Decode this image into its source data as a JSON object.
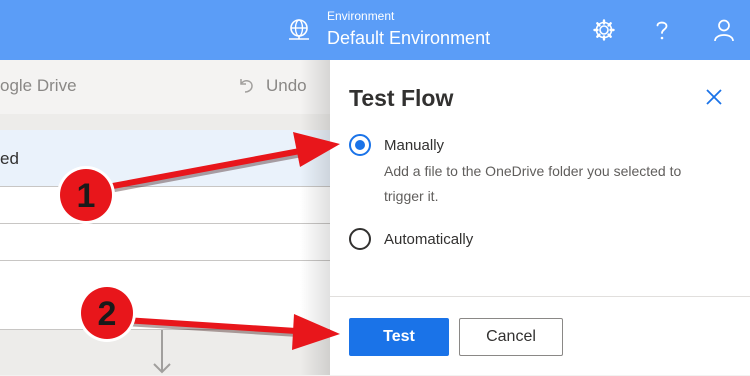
{
  "topbar": {
    "env_label": "Environment",
    "env_name": "Default Environment",
    "icons": [
      "globe-icon",
      "gear-icon",
      "help-icon",
      "user-icon"
    ]
  },
  "background": {
    "toolbar_title": "ogle Drive",
    "undo_label": "Undo",
    "row_text": "ed"
  },
  "panel": {
    "title": "Test Flow",
    "options": [
      {
        "label": "Manually",
        "selected": true,
        "description": "Add a file to the OneDrive folder you selected to trigger it."
      },
      {
        "label": "Automatically",
        "selected": false
      }
    ],
    "test_label": "Test",
    "cancel_label": "Cancel"
  },
  "annotations": [
    {
      "number": "1"
    },
    {
      "number": "2"
    }
  ],
  "colors": {
    "topbar": "#5b9df7",
    "primary": "#1a73e8",
    "annotation": "#e8161b"
  }
}
